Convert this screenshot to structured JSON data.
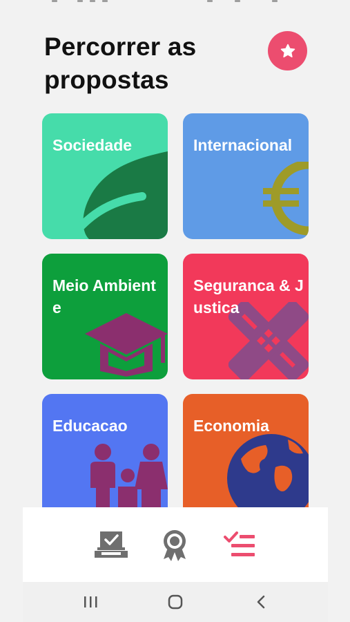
{
  "page": {
    "title": "Percorrer as propostas"
  },
  "favorites": {
    "icon": "star-icon",
    "color": "#ec4d6f"
  },
  "categories": [
    {
      "label": "Sociedade",
      "color": "#46dcaa",
      "icon": "leaf-icon"
    },
    {
      "label": "Internacional",
      "color": "#5f9be6",
      "icon": "euro-icon"
    },
    {
      "label": "Meio Ambiente",
      "color": "#0d9f3c",
      "icon": "graduation-cap-icon"
    },
    {
      "label": "Seguranca & Justica",
      "color": "#f2395a",
      "icon": "bandage-icon"
    },
    {
      "label": "Educacao",
      "color": "#5376f2",
      "icon": "family-icon"
    },
    {
      "label": "Economia",
      "color": "#e75f28",
      "icon": "globe-icon"
    }
  ],
  "bottom_nav": {
    "items": [
      {
        "name": "vote",
        "icon": "ballot-box-icon",
        "active": false
      },
      {
        "name": "awards",
        "icon": "award-badge-icon",
        "active": false
      },
      {
        "name": "proposals",
        "icon": "checklist-icon",
        "active": true
      }
    ],
    "active_color": "#ec4d6f",
    "inactive_color": "#6f6f6f"
  },
  "system_nav": {
    "items": [
      "recents-icon",
      "home-icon",
      "back-icon"
    ]
  }
}
